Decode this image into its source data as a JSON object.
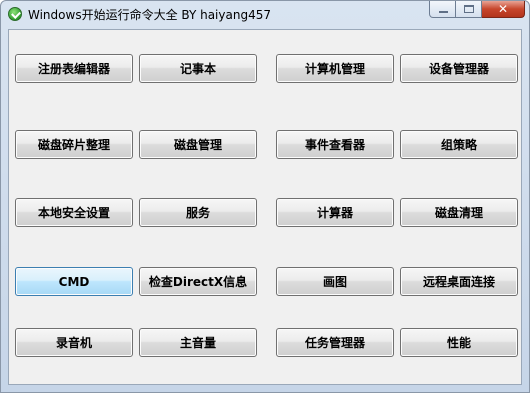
{
  "window": {
    "title": "Windows开始运行命令大全 BY haiyang457",
    "close_glyph": "✕"
  },
  "buttons": [
    {
      "id": "regedit",
      "label": "注册表编辑器"
    },
    {
      "id": "notepad",
      "label": "记事本"
    },
    {
      "id": "compmgmt",
      "label": "计算机管理"
    },
    {
      "id": "devmgmt",
      "label": "设备管理器"
    },
    {
      "id": "defrag",
      "label": "磁盘碎片整理"
    },
    {
      "id": "diskmgmt",
      "label": "磁盘管理"
    },
    {
      "id": "eventvwr",
      "label": "事件查看器"
    },
    {
      "id": "gpedit",
      "label": "组策略"
    },
    {
      "id": "secpol",
      "label": "本地安全设置"
    },
    {
      "id": "services",
      "label": "服务"
    },
    {
      "id": "calc",
      "label": "计算器"
    },
    {
      "id": "cleanmgr",
      "label": "磁盘清理"
    },
    {
      "id": "cmd",
      "label": "CMD"
    },
    {
      "id": "dxdiag",
      "label": "检查DirectX信息"
    },
    {
      "id": "mspaint",
      "label": "画图"
    },
    {
      "id": "mstsc",
      "label": "远程桌面连接"
    },
    {
      "id": "soundrec",
      "label": "录音机"
    },
    {
      "id": "sndvol",
      "label": "主音量"
    },
    {
      "id": "taskmgr",
      "label": "任务管理器"
    },
    {
      "id": "perfmon",
      "label": "性能"
    }
  ]
}
